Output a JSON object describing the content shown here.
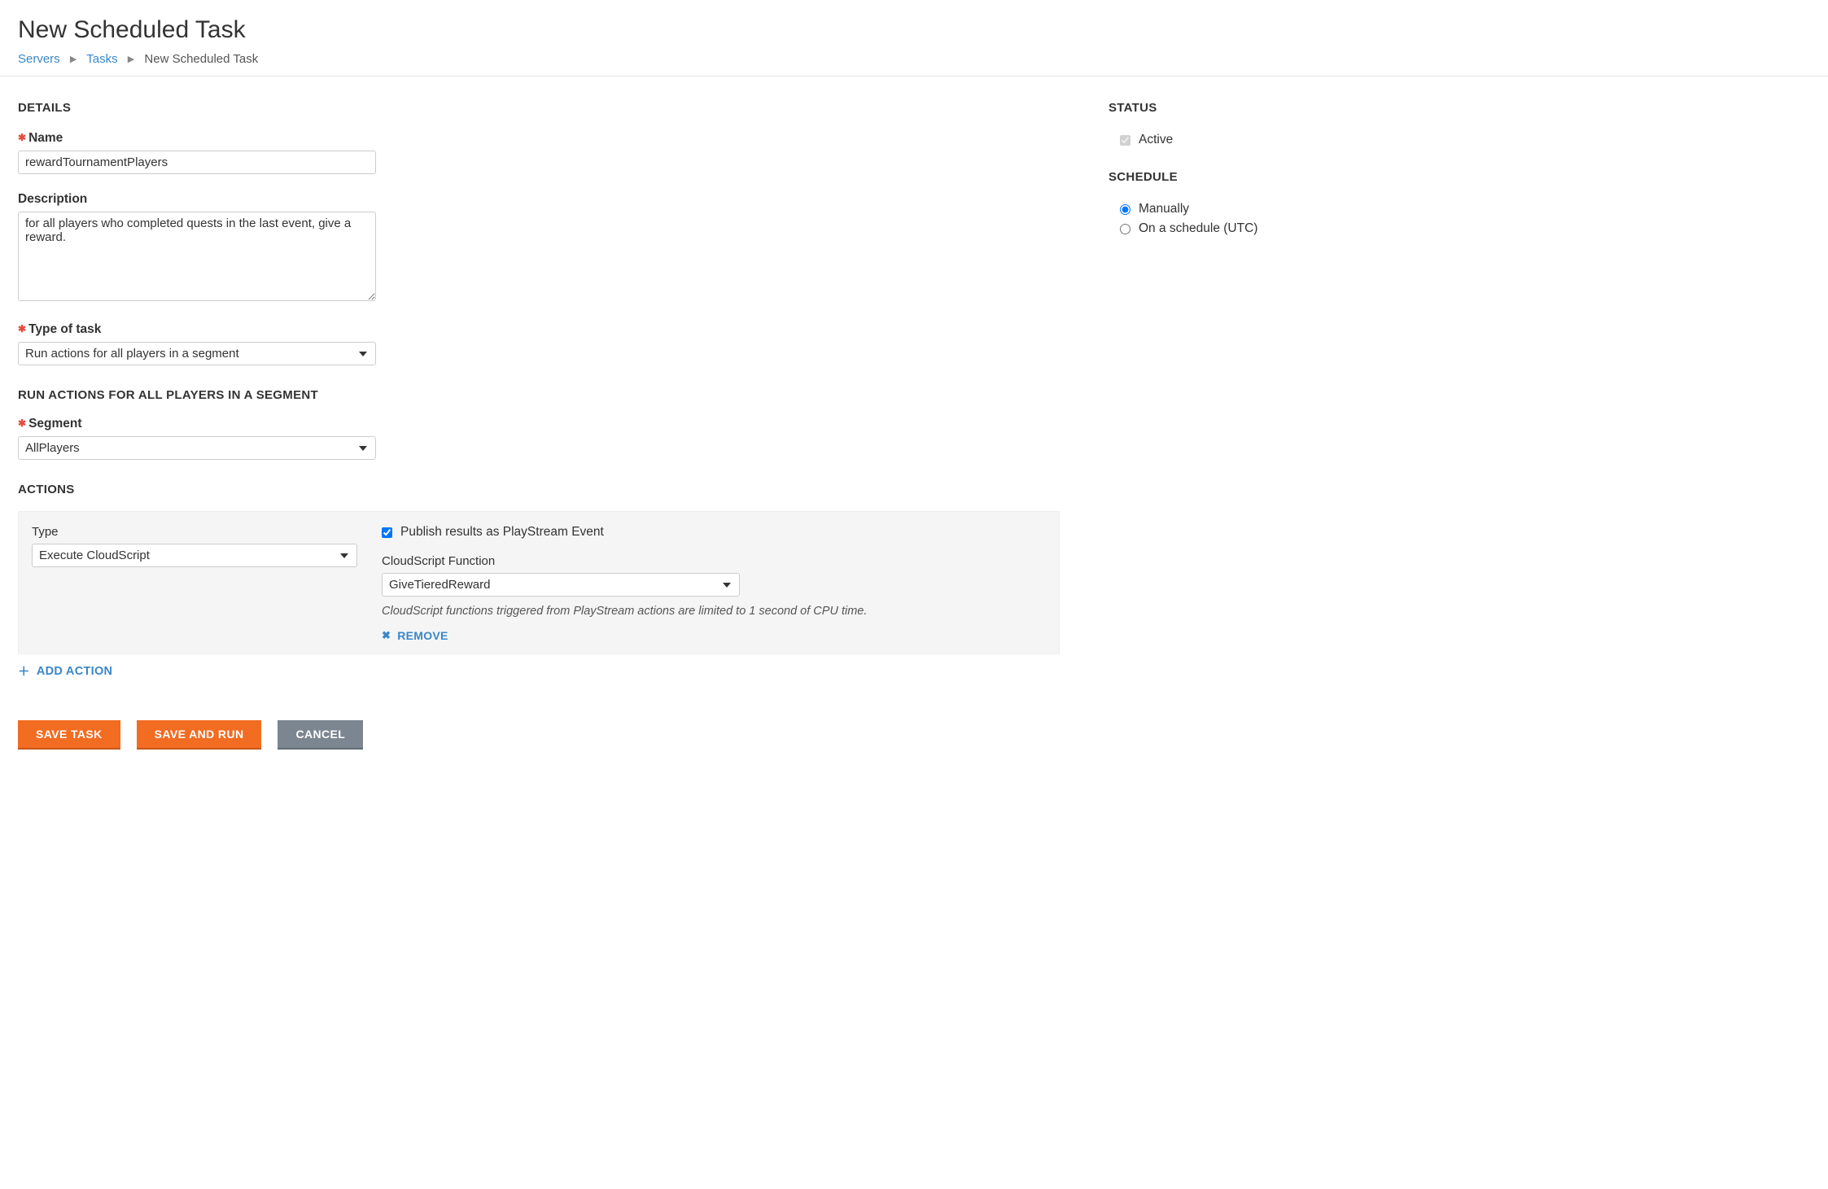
{
  "header": {
    "title": "New Scheduled Task",
    "breadcrumb": {
      "servers": "Servers",
      "tasks": "Tasks",
      "current": "New Scheduled Task"
    }
  },
  "details": {
    "section_label": "DETAILS",
    "name_label": "Name",
    "name_value": "rewardTournamentPlayers",
    "description_label": "Description",
    "description_value": "for all players who completed quests in the last event, give a reward.",
    "task_type_label": "Type of task",
    "task_type_value": "Run actions for all players in a segment",
    "segment_section_label": "RUN ACTIONS FOR ALL PLAYERS IN A SEGMENT",
    "segment_label": "Segment",
    "segment_value": "AllPlayers"
  },
  "actions": {
    "section_label": "ACTIONS",
    "type_label": "Type",
    "type_value": "Execute CloudScript",
    "publish_label": "Publish results as PlayStream Event",
    "publish_checked": true,
    "function_label": "CloudScript Function",
    "function_value": "GiveTieredReward",
    "help_text": "CloudScript functions triggered from PlayStream actions are limited to 1 second of CPU time.",
    "remove_label": "REMOVE",
    "add_action_label": "ADD ACTION"
  },
  "buttons": {
    "save_task": "SAVE TASK",
    "save_and_run": "SAVE AND RUN",
    "cancel": "CANCEL"
  },
  "status": {
    "section_label": "STATUS",
    "active_label": "Active",
    "active_checked": true
  },
  "schedule": {
    "section_label": "SCHEDULE",
    "manual_label": "Manually",
    "scheduled_label": "On a schedule (UTC)",
    "selected": "manual"
  }
}
